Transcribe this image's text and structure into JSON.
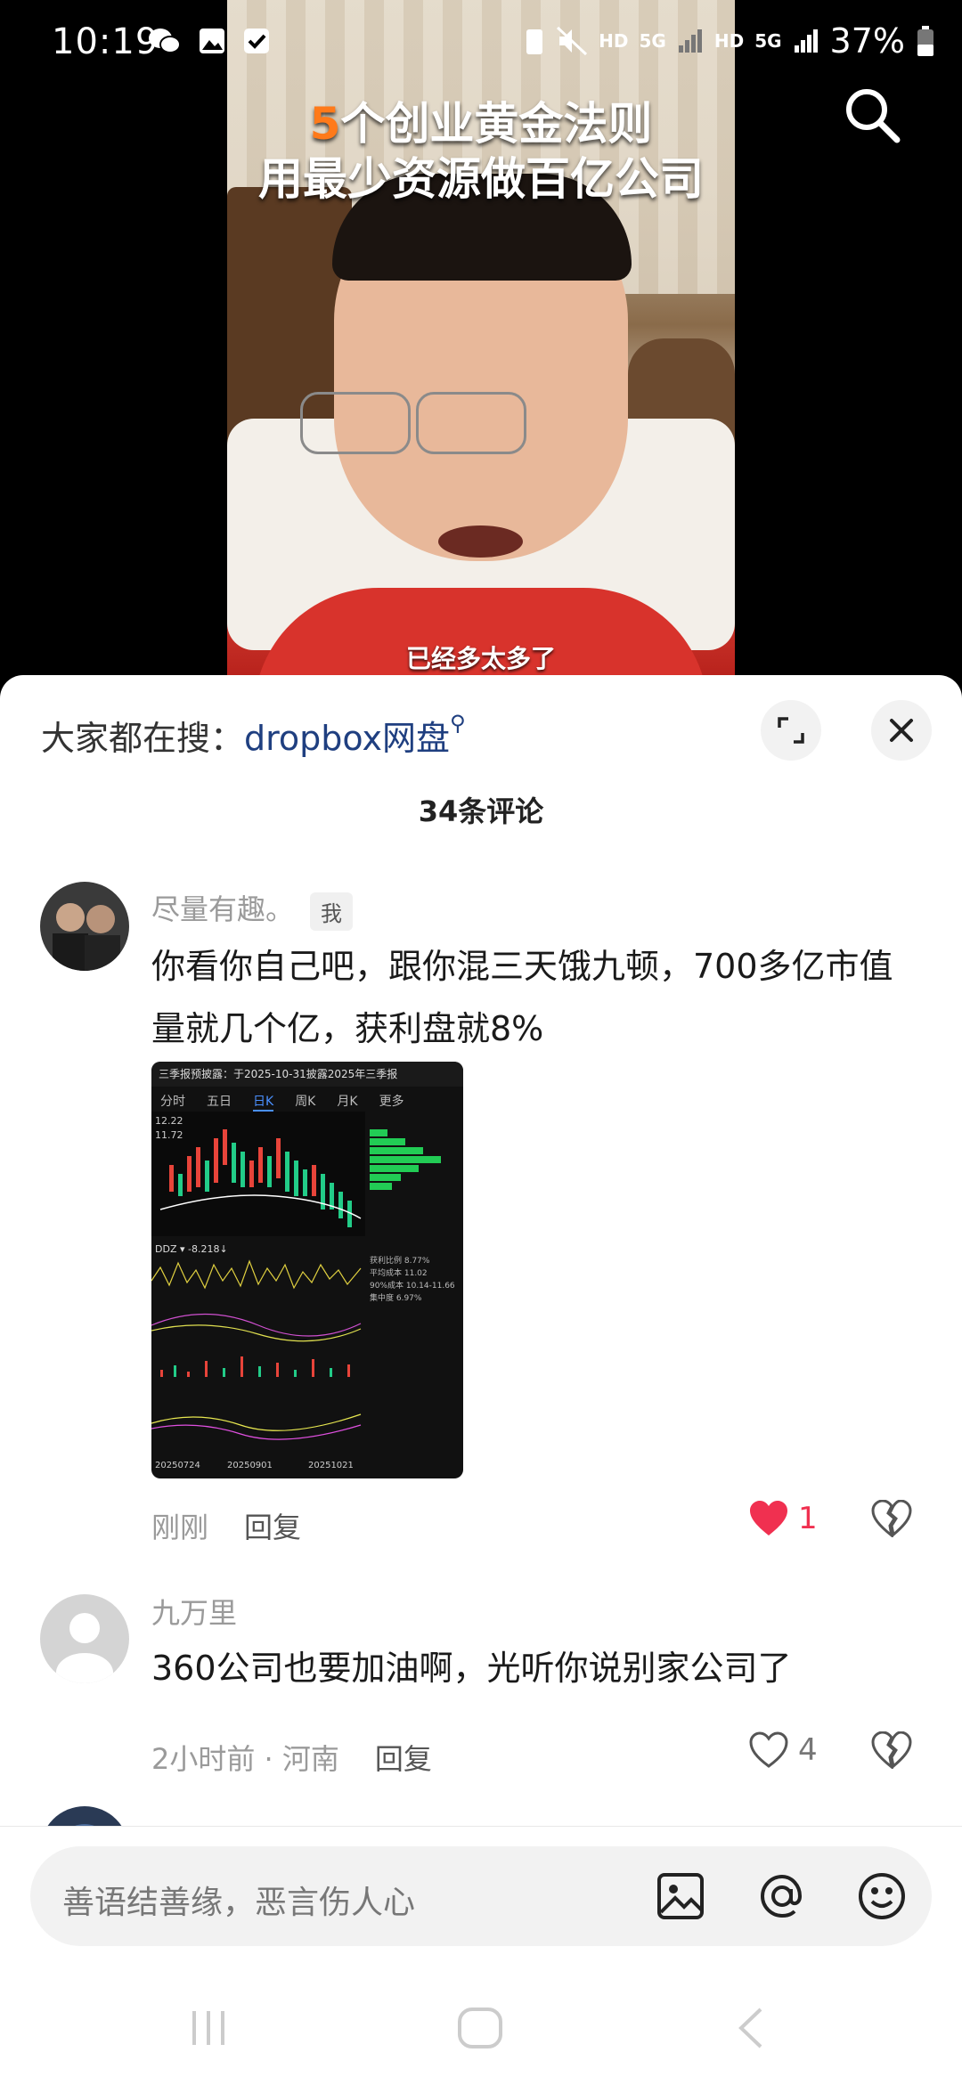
{
  "status": {
    "time": "10:19",
    "battery": "37%",
    "net1": "HD",
    "net2": "5G",
    "net3": "HD",
    "net4": "5G"
  },
  "video": {
    "title_highlight": "5",
    "title_line1": "个创业黄金法则",
    "title_line2": "用最少资源做百亿公司",
    "subtitle": "已经多太多了"
  },
  "sheet": {
    "hot_search_label": "大家都在搜：",
    "hot_search_keyword": "dropbox网盘",
    "comment_count": "34条评论"
  },
  "comments": [
    {
      "username": "尽量有趣。",
      "badge": "我",
      "text": "你看你自己吧，跟你混三天饿九顿，700多亿市值量就几个亿，获利盘就8%",
      "time": "刚刚",
      "reply": "回复",
      "likes": "1",
      "liked": true,
      "image": {
        "header": "三季报预披露：于2025-10-31披露2025年三季报",
        "tabs": [
          "分时",
          "五日",
          "日K",
          "周K",
          "月K",
          "更多"
        ],
        "active_tab": "日K",
        "price_high": "12.22",
        "price_mid": "11.72",
        "ddz_label": "DDZ ▾ -8.218↓",
        "stats": [
          "获利比例 8.77%",
          "平均成本 11.02",
          "90%成本 10.14-11.66",
          "集中度 6.97%"
        ],
        "dates": [
          "20250724",
          "20250901",
          "20251021"
        ]
      }
    },
    {
      "username": "九万里",
      "text": "360公司也要加油啊，光听你说别家公司了",
      "time": "2小时前 · 河南",
      "reply": "回复",
      "likes": "4",
      "liked": false
    }
  ],
  "input": {
    "placeholder": "善语结善缘，恶言伤人心"
  },
  "colors": {
    "accent_red": "#f03050",
    "keyword_blue": "#1f3f80",
    "video_title_orange": "#ff7a1a"
  }
}
